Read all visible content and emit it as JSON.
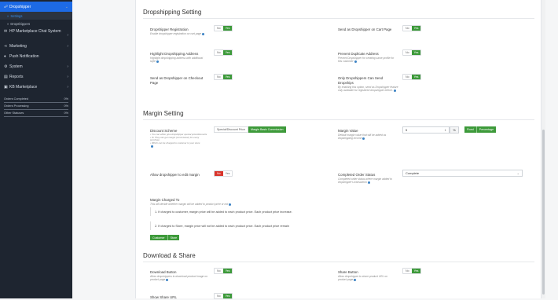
{
  "sidebar": {
    "active_item": "Dropshipper",
    "sub_items": [
      "Settings",
      "Dropshippers"
    ],
    "items": [
      "HP Marketplace Chat System",
      "Marketing",
      "Push Notification",
      "System",
      "Reports",
      "KB Marketplace"
    ],
    "stats": [
      {
        "label": "Orders Completed",
        "value": "0%"
      },
      {
        "label": "Orders Processing",
        "value": "0%"
      },
      {
        "label": "Other Statuses",
        "value": "0%"
      }
    ]
  },
  "dropshipping": {
    "title": "Dropshipping Setting",
    "fields": [
      {
        "label": "Dropshipper Registration",
        "desc": "Enable dropshipper registration on cart page",
        "no": "No",
        "yes": "Yes",
        "value": "Yes"
      },
      {
        "label": "Send as Dropshipper on Cart Page",
        "desc": "",
        "no": "No",
        "yes": "Yes",
        "value": "Yes"
      },
      {
        "label": "Highlight Dropshipping Address",
        "desc": "Highlight dropshipping address with additional style",
        "no": "No",
        "yes": "Yes",
        "value": "Yes"
      },
      {
        "label": "Prevent Duplicate Address",
        "desc": "Prevent Dropshipper for creating same profile for this customer",
        "no": "No",
        "yes": "Yes",
        "value": "Yes"
      },
      {
        "label": "Send as Dropshipper on Checkout Page",
        "desc": "",
        "no": "No",
        "yes": "Yes",
        "value": "Yes"
      },
      {
        "label": "Only Dropshippers Can Send Dropships",
        "desc": "By enabling this option, send as Dropshipper feature only available for registered dropshipper before.",
        "no": "No",
        "yes": "Yes",
        "value": "Yes"
      }
    ]
  },
  "margin": {
    "title": "Margin Setting",
    "discount_scheme": {
      "label": "Discount Scheme",
      "options": [
        "Special/Discount Price",
        "Margin Basic Commission"
      ],
      "selected": "Margin Basic Commission",
      "desc": [
        "You can either give dropshipper special price/discounts",
        "Or They can get margin (commission) for every purchase",
        "Which can be charged to customer to your store"
      ]
    },
    "margin_value": {
      "label": "Margin Value",
      "desc": "Default margin value that will be added as dropshipping income",
      "value": "5",
      "unit": "%",
      "type_options": [
        "Fixed",
        "Percentage"
      ],
      "selected_type": "Percentage"
    },
    "allow_dropshipper": {
      "label": "Allow dropshipper to edit margin",
      "no": "No",
      "yes": "Yes",
      "value": "No"
    },
    "completed_status": {
      "label": "Completed Order Status",
      "desc": "Completed order status where margin added to dropshipper's transaction",
      "value": "Complete"
    },
    "margin_charged_to": {
      "label": "Margin Charged To",
      "desc": "This will decide whether margin will be added to product price or not",
      "notes": [
        "1. If charged to customer, margin price will be added to each product price. Each product price increase.",
        "2. If charged to Store, margin price will not be added to each product price. Each product price remain"
      ],
      "options": [
        "Customer",
        "Store"
      ],
      "selected": "Customer"
    }
  },
  "download": {
    "title": "Download & Share",
    "fields": [
      {
        "label": "Download Button",
        "desc": "Allow dropshippers to download product image on product page",
        "no": "No",
        "yes": "Yes",
        "value": "Yes"
      },
      {
        "label": "Share Button",
        "desc": "Allow dropshipper to share product URL on product page",
        "no": "No",
        "yes": "Yes",
        "value": "Yes"
      },
      {
        "label": "Show Share URL",
        "desc": "",
        "no": "No",
        "yes": "Yes",
        "value": "Yes"
      }
    ]
  },
  "colors": {
    "primary": "#1d6ae5",
    "success": "#3d9a3a",
    "danger": "#d9342b",
    "sidebar": "#1e2530"
  }
}
